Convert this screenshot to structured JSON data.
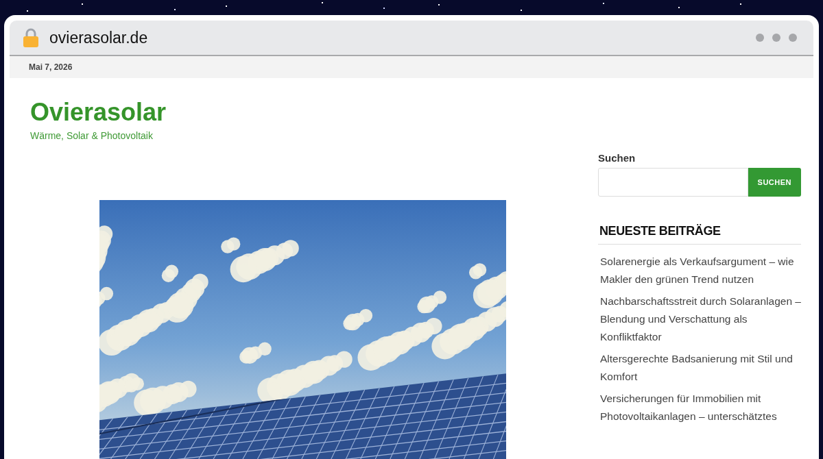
{
  "browser": {
    "url": "ovierasolar.de",
    "secure": true
  },
  "top_bar": {
    "date": "Mai 7, 2026"
  },
  "site": {
    "title": "Ovierasolar",
    "tagline": "Wärme, Solar & Photovoltaik"
  },
  "sidebar": {
    "search": {
      "label": "Suchen",
      "button": "SUCHEN"
    },
    "recent_posts": {
      "title": "NEUESTE BEITRÄGE",
      "items": [
        "Solarenergie als Verkaufsargument – wie Makler den grünen Trend nutzen",
        "Nachbarschaftsstreit durch Solaranlagen – Blendung und Verschattung als Konfliktfaktor",
        "Altersgerechte Badsanierung mit Stil und Komfort",
        "Versicherungen für Immobilien mit Photovoltaikanlagen – unterschätztes"
      ]
    }
  }
}
